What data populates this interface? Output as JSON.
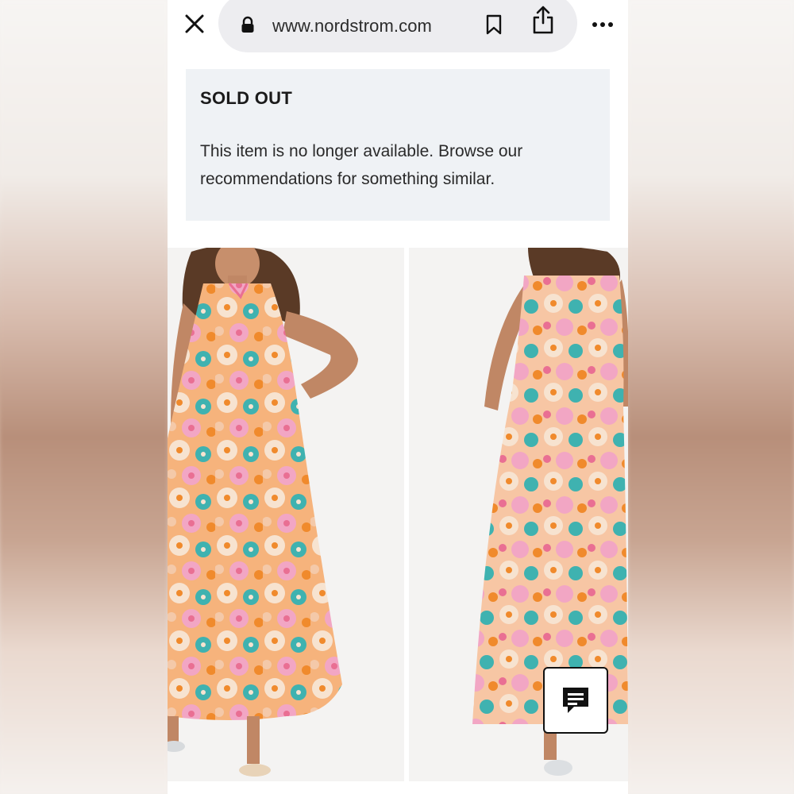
{
  "browser": {
    "url": "www.nordstrom.com",
    "icons": {
      "close": "close-icon",
      "lock": "lock-icon",
      "bookmark": "bookmark-icon",
      "share": "share-icon",
      "more": "more-icon"
    }
  },
  "banner": {
    "title": "SOLD OUT",
    "message": "This item is no longer available. Browse our recommendations for something similar."
  },
  "product_images": [
    {
      "view": "front",
      "description_icon": "product-image-front"
    },
    {
      "view": "back",
      "description_icon": "product-image-back"
    }
  ],
  "chat": {
    "icon": "chat-icon"
  },
  "colors": {
    "banner_bg": "#eff2f5",
    "url_pill": "#ededf0",
    "dress_orange": "#f08a2c",
    "dress_pink": "#f2a6c4",
    "dress_teal": "#3fb2b0",
    "dress_cream": "#f7e3d0"
  }
}
